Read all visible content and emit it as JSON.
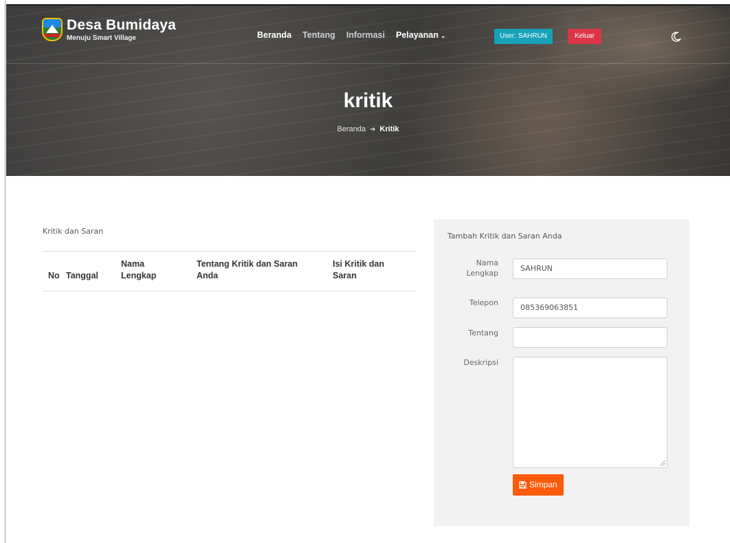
{
  "header": {
    "brand_title": "Desa Bumidaya",
    "brand_subtitle": "Menuju Smart Village",
    "nav": [
      {
        "label": "Beranda"
      },
      {
        "label": "Tentang"
      },
      {
        "label": "Informasi"
      },
      {
        "label": "Pelayanan"
      }
    ],
    "user_badge": "User: SAHRUN",
    "logout_label": "Keluar"
  },
  "hero": {
    "title": "kritik",
    "breadcrumb_home": "Beranda",
    "breadcrumb_current": "Kritik"
  },
  "table_section": {
    "label": "Kritik dan Saran",
    "columns": [
      "No",
      "Tanggal",
      "Nama\nLengkap",
      "Tentang Kritik dan Saran\nAnda",
      "Isi Kritik dan\nSaran"
    ],
    "rows": []
  },
  "form": {
    "title": "Tambah Kritik dan Saran Anda",
    "fields": [
      {
        "label": "Nama Lengkap",
        "value": "SAHRUN"
      },
      {
        "label": "Telepon",
        "value": "085369063851"
      },
      {
        "label": "Tentang",
        "value": ""
      },
      {
        "label": "Deskripsi",
        "value": ""
      }
    ],
    "submit_label": "Simpan"
  },
  "colors": {
    "accent": "#fd5b0a",
    "user_badge": "#17a2b8",
    "logout": "#dc3545"
  },
  "icons": {
    "moon": "moon-icon",
    "save": "floppy-disk-icon",
    "chevron": "chevron-down-icon",
    "arrow": "arrow-right-icon"
  }
}
